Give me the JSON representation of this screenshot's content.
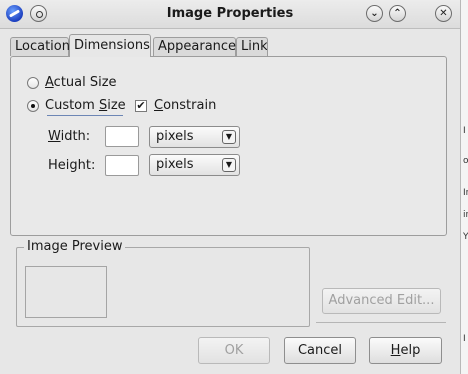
{
  "window": {
    "title": "Image Properties",
    "minimize_glyph": "⌄",
    "maximize_glyph": "⌃",
    "close_glyph": "✕"
  },
  "tabs": [
    {
      "label": "Location",
      "active": false
    },
    {
      "label": "Dimensions",
      "active": true
    },
    {
      "label": "Appearance",
      "active": false
    },
    {
      "label": "Link",
      "active": false
    }
  ],
  "dimensions": {
    "actual_size": {
      "prefix": "",
      "mnemonic": "A",
      "rest": "ctual Size",
      "checked": false
    },
    "custom_size": {
      "prefix": "Custom ",
      "mnemonic": "S",
      "rest": "ize",
      "checked": true
    },
    "constrain": {
      "prefix": "",
      "mnemonic": "C",
      "rest": "onstrain",
      "checked": true,
      "check_glyph": "✔"
    },
    "width": {
      "prefix": "",
      "mnemonic": "W",
      "rest": "idth:",
      "value": "",
      "unit": "pixels"
    },
    "height": {
      "prefix": "",
      "mnemonic": "",
      "rest": "Height:",
      "value": "",
      "unit": "pixels"
    },
    "dropdown_glyph": "▼"
  },
  "preview": {
    "title": "Image Preview",
    "advanced_edit_label": "Advanced Edit..."
  },
  "footer": {
    "ok_label": "OK",
    "cancel_label": "Cancel",
    "help_prefix": "",
    "help_mnemonic": "H",
    "help_rest": "elp"
  },
  "background_strip": {
    "marks": [
      "I",
      "o",
      "Ir",
      "ir",
      "Y",
      "I"
    ]
  }
}
